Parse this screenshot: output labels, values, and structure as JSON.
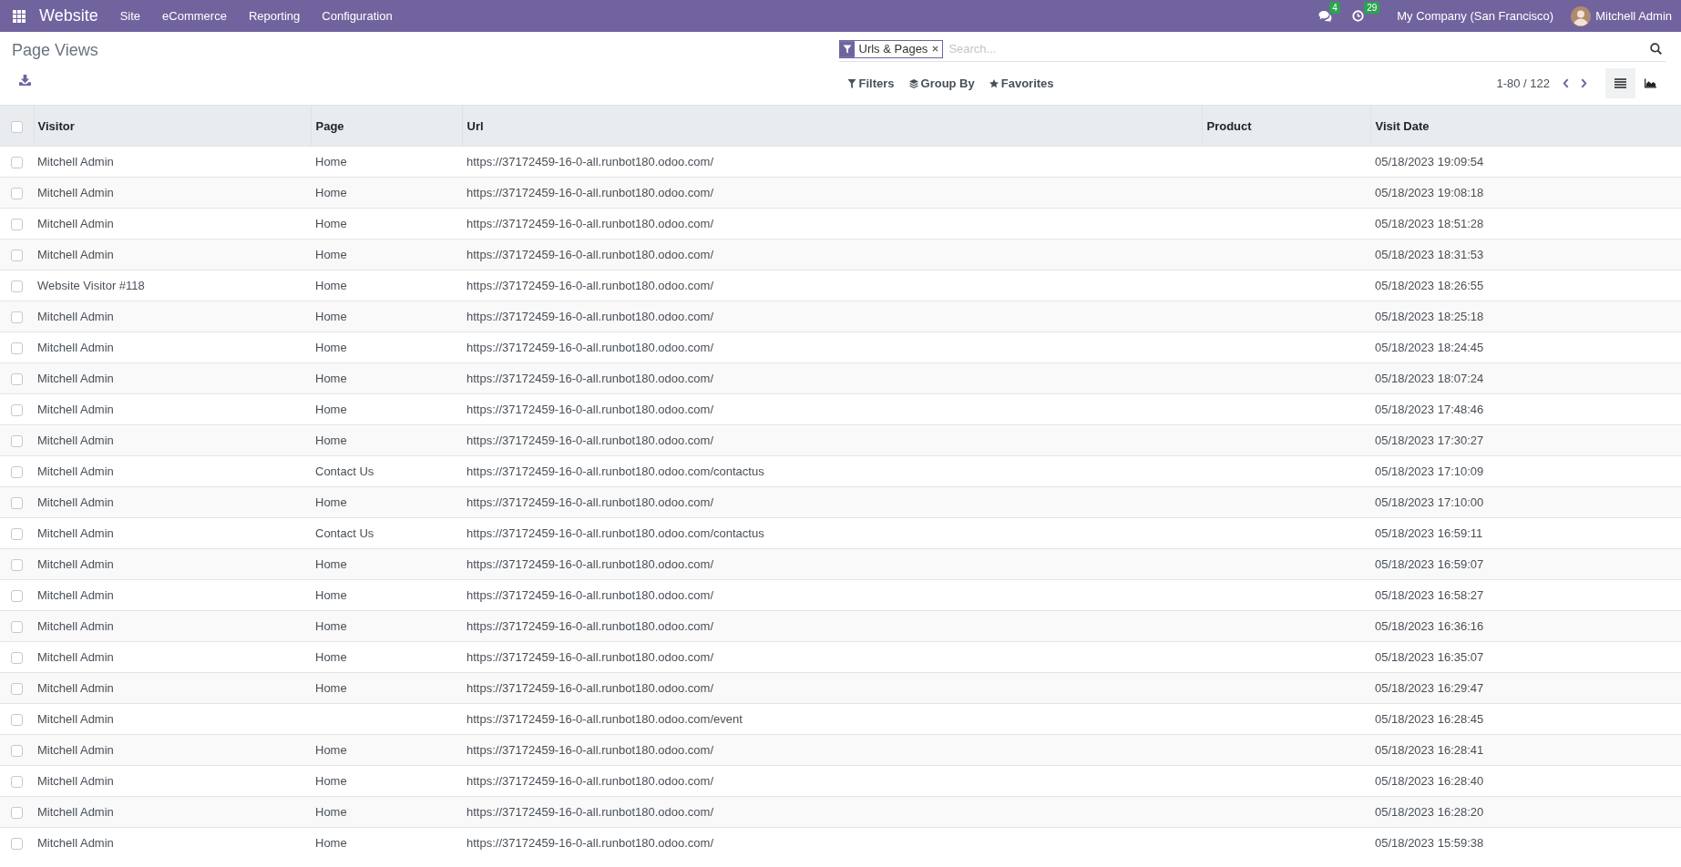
{
  "navbar": {
    "app_name": "Website",
    "menus": [
      "Site",
      "eCommerce",
      "Reporting",
      "Configuration"
    ],
    "messages_count": "4",
    "activities_count": "29",
    "company": "My Company (San Francisco)",
    "user": "Mitchell Admin"
  },
  "control_panel": {
    "breadcrumb": "Page Views",
    "search": {
      "facets": [
        {
          "label": "Urls & Pages"
        }
      ],
      "placeholder": "Search..."
    },
    "search_options": [
      {
        "kind": "filter",
        "label": "Filters"
      },
      {
        "kind": "group",
        "label": "Group By"
      },
      {
        "kind": "favorite",
        "label": "Favorites"
      }
    ],
    "pager": "1-80 / 122",
    "views": [
      {
        "kind": "list",
        "selected": true
      },
      {
        "kind": "graph",
        "selected": false
      }
    ]
  },
  "table": {
    "all_checked": false,
    "columns": [
      "Visitor",
      "Page",
      "Url",
      "Product",
      "Visit Date"
    ],
    "rows": [
      {
        "checked": false,
        "visitor": "Mitchell Admin",
        "page": "Home",
        "url": "https://37172459-16-0-all.runbot180.odoo.com/",
        "visit_date": "05/18/2023 19:09:54"
      },
      {
        "checked": false,
        "visitor": "Mitchell Admin",
        "page": "Home",
        "url": "https://37172459-16-0-all.runbot180.odoo.com/",
        "visit_date": "05/18/2023 19:08:18"
      },
      {
        "checked": false,
        "visitor": "Mitchell Admin",
        "page": "Home",
        "url": "https://37172459-16-0-all.runbot180.odoo.com/",
        "visit_date": "05/18/2023 18:51:28"
      },
      {
        "checked": false,
        "visitor": "Mitchell Admin",
        "page": "Home",
        "url": "https://37172459-16-0-all.runbot180.odoo.com/",
        "visit_date": "05/18/2023 18:31:53"
      },
      {
        "checked": false,
        "visitor": "Website Visitor #118",
        "page": "Home",
        "url": "https://37172459-16-0-all.runbot180.odoo.com/",
        "visit_date": "05/18/2023 18:26:55"
      },
      {
        "checked": false,
        "visitor": "Mitchell Admin",
        "page": "Home",
        "url": "https://37172459-16-0-all.runbot180.odoo.com/",
        "visit_date": "05/18/2023 18:25:18"
      },
      {
        "checked": false,
        "visitor": "Mitchell Admin",
        "page": "Home",
        "url": "https://37172459-16-0-all.runbot180.odoo.com/",
        "visit_date": "05/18/2023 18:24:45"
      },
      {
        "checked": false,
        "visitor": "Mitchell Admin",
        "page": "Home",
        "url": "https://37172459-16-0-all.runbot180.odoo.com/",
        "visit_date": "05/18/2023 18:07:24"
      },
      {
        "checked": false,
        "visitor": "Mitchell Admin",
        "page": "Home",
        "url": "https://37172459-16-0-all.runbot180.odoo.com/",
        "visit_date": "05/18/2023 17:48:46"
      },
      {
        "checked": false,
        "visitor": "Mitchell Admin",
        "page": "Home",
        "url": "https://37172459-16-0-all.runbot180.odoo.com/",
        "visit_date": "05/18/2023 17:30:27"
      },
      {
        "checked": false,
        "visitor": "Mitchell Admin",
        "page": "Contact Us",
        "url": "https://37172459-16-0-all.runbot180.odoo.com/contactus",
        "visit_date": "05/18/2023 17:10:09"
      },
      {
        "checked": false,
        "visitor": "Mitchell Admin",
        "page": "Home",
        "url": "https://37172459-16-0-all.runbot180.odoo.com/",
        "visit_date": "05/18/2023 17:10:00"
      },
      {
        "checked": false,
        "visitor": "Mitchell Admin",
        "page": "Contact Us",
        "url": "https://37172459-16-0-all.runbot180.odoo.com/contactus",
        "visit_date": "05/18/2023 16:59:11"
      },
      {
        "checked": false,
        "visitor": "Mitchell Admin",
        "page": "Home",
        "url": "https://37172459-16-0-all.runbot180.odoo.com/",
        "visit_date": "05/18/2023 16:59:07"
      },
      {
        "checked": false,
        "visitor": "Mitchell Admin",
        "page": "Home",
        "url": "https://37172459-16-0-all.runbot180.odoo.com/",
        "visit_date": "05/18/2023 16:58:27"
      },
      {
        "checked": false,
        "visitor": "Mitchell Admin",
        "page": "Home",
        "url": "https://37172459-16-0-all.runbot180.odoo.com/",
        "visit_date": "05/18/2023 16:36:16"
      },
      {
        "checked": false,
        "visitor": "Mitchell Admin",
        "page": "Home",
        "url": "https://37172459-16-0-all.runbot180.odoo.com/",
        "visit_date": "05/18/2023 16:35:07"
      },
      {
        "checked": false,
        "visitor": "Mitchell Admin",
        "page": "Home",
        "url": "https://37172459-16-0-all.runbot180.odoo.com/",
        "visit_date": "05/18/2023 16:29:47"
      },
      {
        "checked": false,
        "visitor": "Mitchell Admin",
        "url": "https://37172459-16-0-all.runbot180.odoo.com/event",
        "visit_date": "05/18/2023 16:28:45"
      },
      {
        "checked": false,
        "visitor": "Mitchell Admin",
        "page": "Home",
        "url": "https://37172459-16-0-all.runbot180.odoo.com/",
        "visit_date": "05/18/2023 16:28:41"
      },
      {
        "checked": false,
        "visitor": "Mitchell Admin",
        "page": "Home",
        "url": "https://37172459-16-0-all.runbot180.odoo.com/",
        "visit_date": "05/18/2023 16:28:40"
      },
      {
        "checked": false,
        "visitor": "Mitchell Admin",
        "page": "Home",
        "url": "https://37172459-16-0-all.runbot180.odoo.com/",
        "visit_date": "05/18/2023 16:28:20"
      },
      {
        "checked": false,
        "visitor": "Mitchell Admin",
        "page": "Home",
        "url": "https://37172459-16-0-all.runbot180.odoo.com/",
        "visit_date": "05/18/2023 15:59:38"
      }
    ]
  }
}
